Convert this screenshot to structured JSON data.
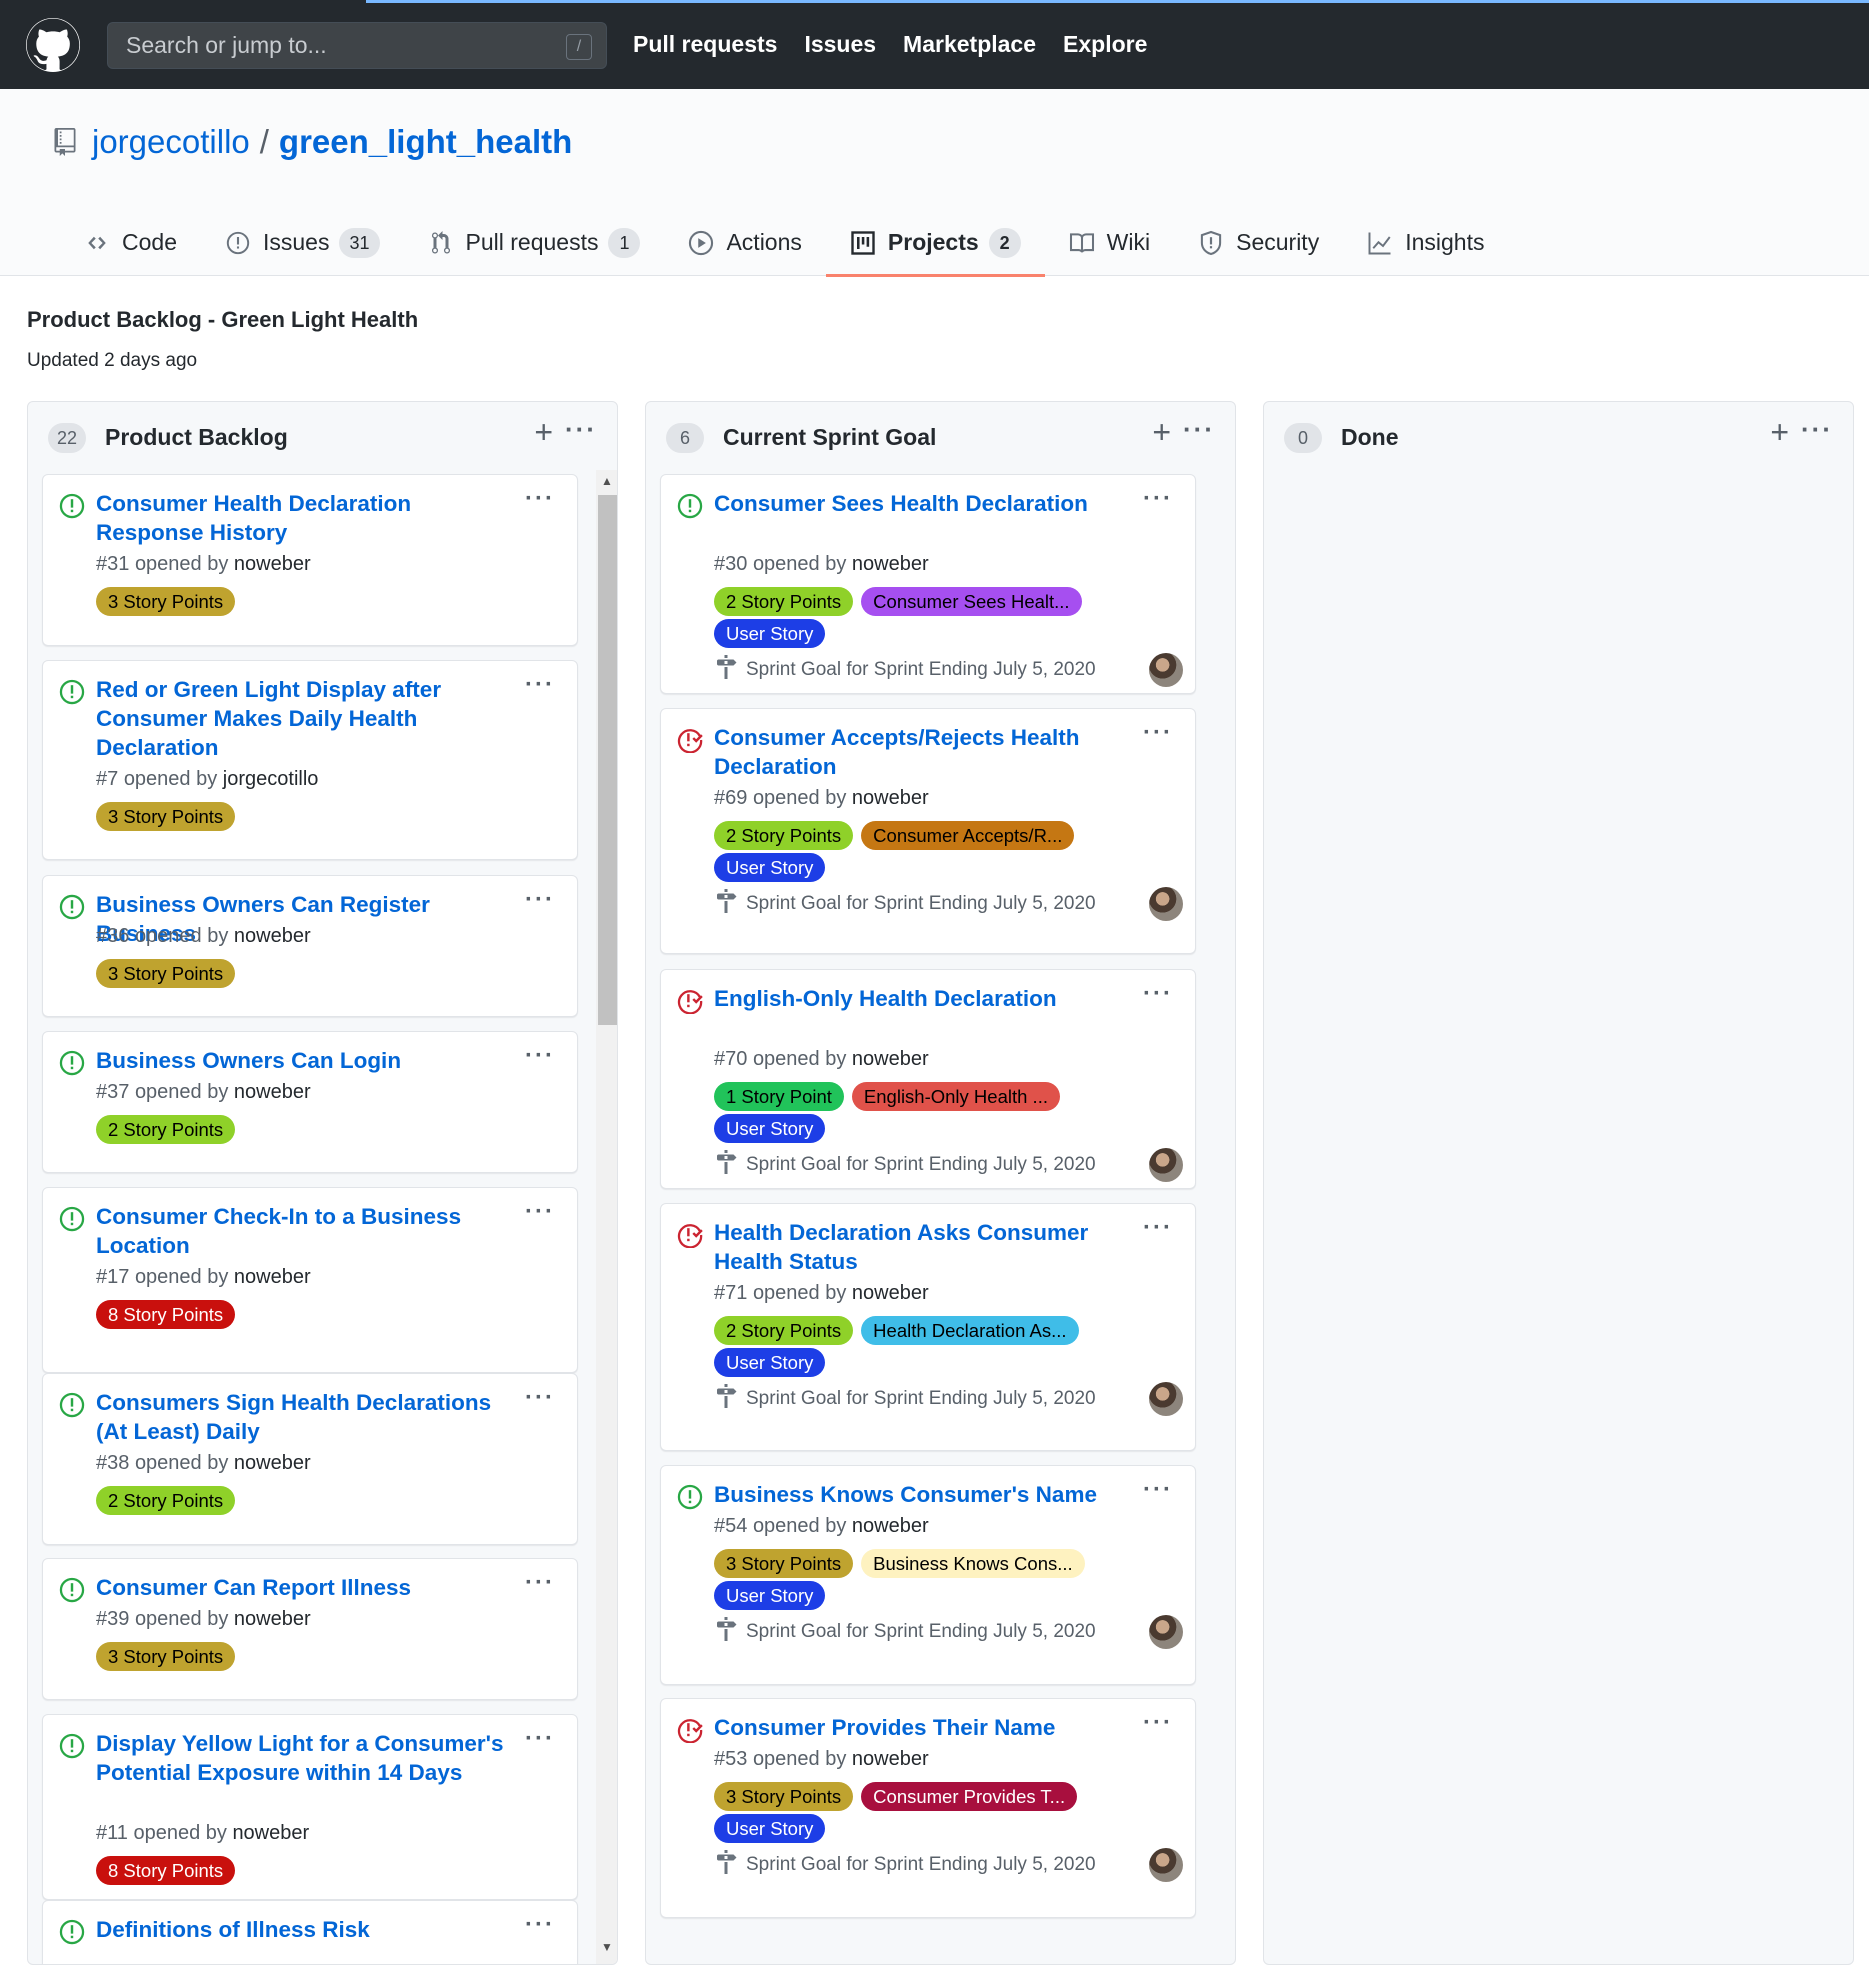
{
  "header": {
    "search_placeholder": "Search or jump to...",
    "search_key": "/",
    "nav": [
      "Pull requests",
      "Issues",
      "Marketplace",
      "Explore"
    ]
  },
  "repo": {
    "owner": "jorgecotillo",
    "separator": "/",
    "name": "green_light_health"
  },
  "tabs": [
    {
      "label": "Code",
      "count": null,
      "icon": "code-icon"
    },
    {
      "label": "Issues",
      "count": "31",
      "icon": "issue-opened-icon"
    },
    {
      "label": "Pull requests",
      "count": "1",
      "icon": "git-pull-request-icon"
    },
    {
      "label": "Actions",
      "count": null,
      "icon": "play-icon"
    },
    {
      "label": "Projects",
      "count": "2",
      "icon": "project-icon"
    },
    {
      "label": "Wiki",
      "count": null,
      "icon": "book-icon"
    },
    {
      "label": "Security",
      "count": null,
      "icon": "shield-icon"
    },
    {
      "label": "Insights",
      "count": null,
      "icon": "graph-icon"
    }
  ],
  "project": {
    "title": "Product Backlog - Green Light Health",
    "updated": "Updated 2 days ago"
  },
  "colors": {
    "open_icon": "#28a745",
    "closed_icon": "#cb2431",
    "link": "#0366d6",
    "selected_tab": "#f9826c"
  },
  "columns": [
    {
      "count": "22",
      "name": "Product Backlog",
      "cards": [
        {
          "title": "Consumer Health Declaration Response History",
          "number": "#31",
          "opened_by": "opened by",
          "author": "noweber",
          "state": "open",
          "labels": [
            {
              "text": "3 Story Points",
              "bg": "#bfa32f",
              "fg": "#000000"
            }
          ]
        },
        {
          "title": "Red or Green Light Display after Consumer Makes Daily Health Declaration",
          "number": "#7",
          "opened_by": "opened by",
          "author": "jorgecotillo",
          "state": "open",
          "labels": [
            {
              "text": "3 Story Points",
              "bg": "#bfa32f",
              "fg": "#000000"
            }
          ]
        },
        {
          "title": "Business Owners Can Register Business",
          "number": "#36",
          "opened_by": "opened by",
          "author": "noweber",
          "state": "open",
          "labels": [
            {
              "text": "3 Story Points",
              "bg": "#bfa32f",
              "fg": "#000000"
            }
          ]
        },
        {
          "title": "Business Owners Can Login",
          "number": "#37",
          "opened_by": "opened by",
          "author": "noweber",
          "state": "open",
          "labels": [
            {
              "text": "2 Story Points",
              "bg": "#8fd129",
              "fg": "#000000"
            }
          ]
        },
        {
          "title": "Consumer Check-In to a Business Location",
          "number": "#17",
          "opened_by": "opened by",
          "author": "noweber",
          "state": "open",
          "labels": [
            {
              "text": "8 Story Points",
              "bg": "#c9100d",
              "fg": "#ffffff"
            }
          ]
        },
        {
          "title": "Consumers Sign Health Declarations (At Least) Daily",
          "number": "#38",
          "opened_by": "opened by",
          "author": "noweber",
          "state": "open",
          "labels": [
            {
              "text": "2 Story Points",
              "bg": "#8fd129",
              "fg": "#000000"
            }
          ]
        },
        {
          "title": "Consumer Can Report Illness",
          "number": "#39",
          "opened_by": "opened by",
          "author": "noweber",
          "state": "open",
          "labels": [
            {
              "text": "3 Story Points",
              "bg": "#bfa32f",
              "fg": "#000000"
            }
          ]
        },
        {
          "title": "Display Yellow Light for a Consumer's Potential Exposure within 14 Days",
          "number": "#11",
          "opened_by": "opened by",
          "author": "noweber",
          "state": "open",
          "labels": [
            {
              "text": "8 Story Points",
              "bg": "#c9100d",
              "fg": "#ffffff"
            }
          ]
        },
        {
          "title": "Definitions of Illness Risk",
          "number": "",
          "opened_by": "",
          "author": "",
          "state": "open",
          "labels": []
        }
      ]
    },
    {
      "count": "6",
      "name": "Current Sprint Goal",
      "cards": [
        {
          "title": "Consumer Sees Health Declaration",
          "number": "#30",
          "opened_by": "opened by",
          "author": "noweber",
          "state": "open",
          "labels": [
            {
              "text": "2 Story Points",
              "bg": "#8fd129",
              "fg": "#000000"
            },
            {
              "text": "Consumer Sees Healt...",
              "bg": "#a64ff0",
              "fg": "#000000"
            },
            {
              "text": "User Story",
              "bg": "#1d3ee6",
              "fg": "#ffffff"
            }
          ],
          "milestone": "Sprint Goal for Sprint Ending July 5, 2020"
        },
        {
          "title": "Consumer Accepts/Rejects Health Declaration",
          "number": "#69",
          "opened_by": "opened by",
          "author": "noweber",
          "state": "closed",
          "labels": [
            {
              "text": "2 Story Points",
              "bg": "#8fd129",
              "fg": "#000000"
            },
            {
              "text": "Consumer Accepts/R...",
              "bg": "#c57713",
              "fg": "#000000"
            },
            {
              "text": "User Story",
              "bg": "#1d3ee6",
              "fg": "#ffffff"
            }
          ],
          "milestone": "Sprint Goal for Sprint Ending July 5, 2020"
        },
        {
          "title": "English-Only Health Declaration",
          "number": "#70",
          "opened_by": "opened by",
          "author": "noweber",
          "state": "closed",
          "labels": [
            {
              "text": "1 Story Point",
              "bg": "#21c35a",
              "fg": "#000000"
            },
            {
              "text": "English-Only Health ...",
              "bg": "#e0524a",
              "fg": "#000000"
            },
            {
              "text": "User Story",
              "bg": "#1d3ee6",
              "fg": "#ffffff"
            }
          ],
          "milestone": "Sprint Goal for Sprint Ending July 5, 2020"
        },
        {
          "title": "Health Declaration Asks Consumer Health Status",
          "number": "#71",
          "opened_by": "opened by",
          "author": "noweber",
          "state": "closed",
          "labels": [
            {
              "text": "2 Story Points",
              "bg": "#8fd129",
              "fg": "#000000"
            },
            {
              "text": "Health Declaration As...",
              "bg": "#3fbde8",
              "fg": "#000000"
            },
            {
              "text": "User Story",
              "bg": "#1d3ee6",
              "fg": "#ffffff"
            }
          ],
          "milestone": "Sprint Goal for Sprint Ending July 5, 2020"
        },
        {
          "title": "Business Knows Consumer's Name",
          "number": "#54",
          "opened_by": "opened by",
          "author": "noweber",
          "state": "open",
          "labels": [
            {
              "text": "3 Story Points",
              "bg": "#bfa32f",
              "fg": "#000000"
            },
            {
              "text": "Business Knows Cons...",
              "bg": "#fef2c0",
              "fg": "#000000"
            },
            {
              "text": "User Story",
              "bg": "#1d3ee6",
              "fg": "#ffffff"
            }
          ],
          "milestone": "Sprint Goal for Sprint Ending July 5, 2020"
        },
        {
          "title": "Consumer Provides Their Name",
          "number": "#53",
          "opened_by": "opened by",
          "author": "noweber",
          "state": "closed",
          "labels": [
            {
              "text": "3 Story Points",
              "bg": "#bfa32f",
              "fg": "#000000"
            },
            {
              "text": "Consumer Provides T...",
              "bg": "#a80f3e",
              "fg": "#ffffff"
            },
            {
              "text": "User Story",
              "bg": "#1d3ee6",
              "fg": "#ffffff"
            }
          ],
          "milestone": "Sprint Goal for Sprint Ending July 5, 2020"
        }
      ]
    },
    {
      "count": "0",
      "name": "Done",
      "cards": []
    }
  ]
}
